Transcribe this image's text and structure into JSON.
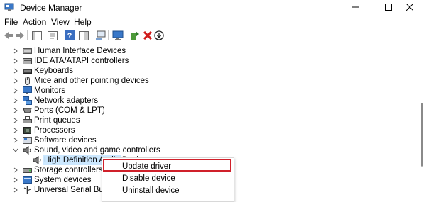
{
  "window": {
    "title": "Device Manager",
    "controls": [
      "minimize-icon",
      "maximize-icon",
      "close-icon"
    ]
  },
  "menu": {
    "items": [
      "File",
      "Action",
      "View",
      "Help"
    ]
  },
  "toolbar": {
    "icons": [
      "back-arrow-icon",
      "forward-arrow-icon",
      "show-hide-console-tree-icon",
      "properties-icon",
      "help-icon",
      "action-pane-icon",
      "scan-hardware-icon",
      "monitor-icon",
      "update-driver-icon",
      "uninstall-icon",
      "disable-icon"
    ]
  },
  "tree": {
    "items": [
      {
        "label": "Human Interface Devices",
        "icon": "hid-icon",
        "expanded": false
      },
      {
        "label": "IDE ATA/ATAPI controllers",
        "icon": "ide-icon",
        "expanded": false
      },
      {
        "label": "Keyboards",
        "icon": "keyboard-icon",
        "expanded": false
      },
      {
        "label": "Mice and other pointing devices",
        "icon": "mouse-icon",
        "expanded": false
      },
      {
        "label": "Monitors",
        "icon": "monitor-icon",
        "expanded": false
      },
      {
        "label": "Network adapters",
        "icon": "network-icon",
        "expanded": false
      },
      {
        "label": "Ports (COM & LPT)",
        "icon": "ports-icon",
        "expanded": false
      },
      {
        "label": "Print queues",
        "icon": "printer-icon",
        "expanded": false
      },
      {
        "label": "Processors",
        "icon": "processor-icon",
        "expanded": false
      },
      {
        "label": "Software devices",
        "icon": "software-icon",
        "expanded": false
      },
      {
        "label": "Sound, video and game controllers",
        "icon": "speaker-icon",
        "expanded": true
      },
      {
        "label": "High Definition Audio Device",
        "icon": "audio-device-icon",
        "child": true,
        "selected": true
      },
      {
        "label": "Storage controllers",
        "icon": "storage-icon",
        "expanded": false
      },
      {
        "label": "System devices",
        "icon": "system-icon",
        "expanded": false
      },
      {
        "label": "Universal Serial Bus controllers",
        "icon": "usb-icon",
        "expanded": false
      }
    ],
    "selected_label_visible": "High Definition Audio Device"
  },
  "context_menu": {
    "items": [
      "Update driver",
      "Disable device",
      "Uninstall device"
    ],
    "highlighted": "Update driver"
  },
  "colors": {
    "selection": "#cce8ff",
    "highlight_border": "#d0202a",
    "accent_blue": "#2b6cc4"
  }
}
